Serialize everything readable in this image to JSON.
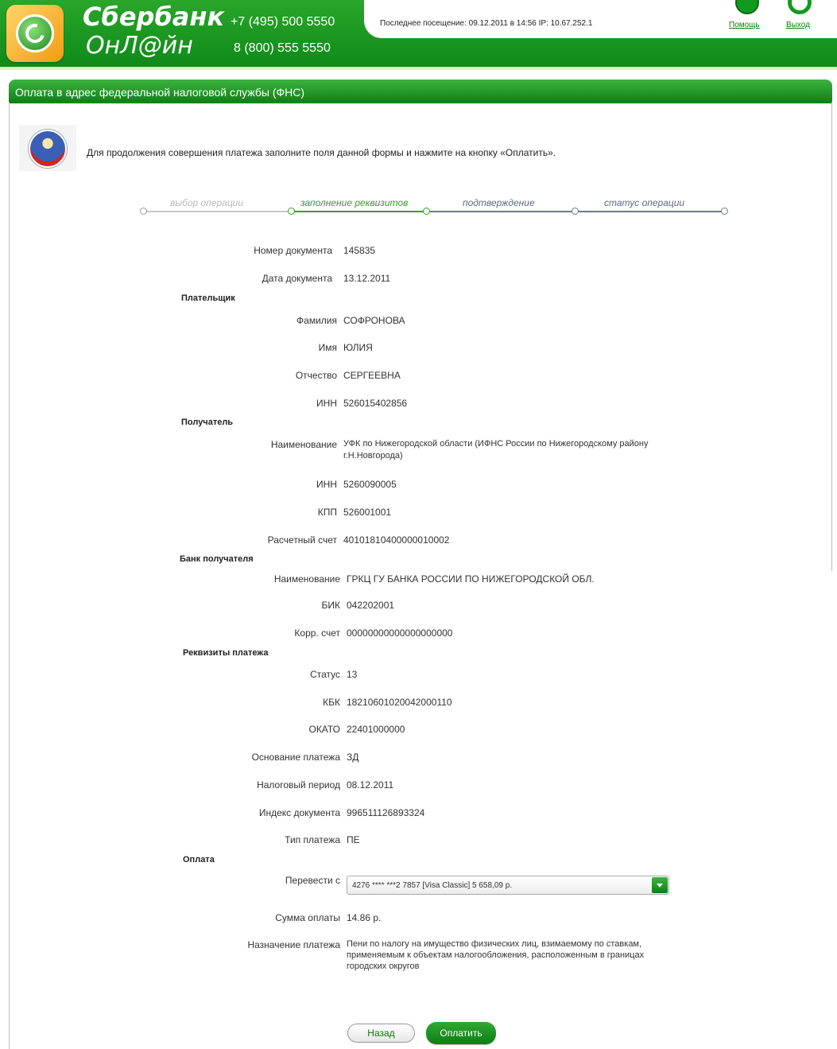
{
  "header": {
    "brand_line1": "Сбербанк",
    "brand_line2": "ОнЛ@йн",
    "phone1": "+7 (495) 500 5550",
    "phone2": "8 (800) 555 5550",
    "last_visit": "Последнее посещение: 09.12.2011 в 14:56 IP: 10.67.252.1",
    "help_link": "Помощь",
    "exit_link": "Выход"
  },
  "panel": {
    "title": "Оплата в адрес федеральной налоговой службы (ФНС)",
    "instructions": "Для продолжения совершения платежа заполните поля данной формы и нажмите на кнопку «Оплатить»."
  },
  "steps": [
    {
      "label": "выбор операции",
      "state": "done"
    },
    {
      "label": "заполнение реквизитов",
      "state": "active"
    },
    {
      "label": "подтверждение",
      "state": "pending"
    },
    {
      "label": "статус операции",
      "state": "pending"
    }
  ],
  "form": {
    "doc_number_label": "Номер документа",
    "doc_number": "145835",
    "doc_date_label": "Дата документа",
    "doc_date": "13.12.2011",
    "payer_section": "Плательщик",
    "surname_label": "Фамилия",
    "surname": "СОФРОНОВА",
    "name_label": "Имя",
    "name": "ЮЛИЯ",
    "patronymic_label": "Отчество",
    "patronymic": "СЕРГЕЕВНА",
    "payer_inn_label": "ИНН",
    "payer_inn": "526015402856",
    "recipient_section": "Получатель",
    "recipient_name_label": "Наименование",
    "recipient_name_line1": "УФК по Нижегородской области (ИФНС России по Нижегородскому району",
    "recipient_name_line2": "г.Н.Новгорода)",
    "recipient_inn_label": "ИНН",
    "recipient_inn": "5260090005",
    "kpp_label": "КПП",
    "kpp": "526001001",
    "account_label": "Расчетный счет",
    "account": "40101810400000010002",
    "bank_section": "Банк получателя",
    "bank_name_label": "Наименование",
    "bank_name": "ГРКЦ ГУ БАНКА РОССИИ ПО НИЖЕГОРОДСКОЙ ОБЛ.",
    "bik_label": "БИК",
    "bik": "042202001",
    "corr_label": "Корр. счет",
    "corr": "00000000000000000000",
    "payment_section": "Реквизиты платежа",
    "status_label": "Статус",
    "status": "13",
    "kbk_label": "КБК",
    "kbk": "18210601020042000110",
    "okato_label": "ОКАТО",
    "okato": "22401000000",
    "basis_label": "Основание платежа",
    "basis": "ЗД",
    "period_label": "Налоговый период",
    "period": "08.12.2011",
    "doc_index_label": "Индекс документа",
    "doc_index": "996511126893324",
    "pay_type_label": "Тип платежа",
    "pay_type": "ПЕ",
    "pay_section": "Оплата",
    "transfer_from_label": "Перевести с",
    "transfer_from": "4276 **** ***2 7857  [Visa Classic] 5 658,09  р.",
    "amount_label": "Сумма оплаты",
    "amount": "14.86  р.",
    "purpose_label": "Назначение платежа",
    "purpose_line1": "Пени по налогу на имущество физических лиц, взимаемому по ставкам,",
    "purpose_line2": "применяемым к объектам налогообложения, расположенным в границах",
    "purpose_line3": "городских округов"
  },
  "buttons": {
    "back": "Назад",
    "pay": "Оплатить"
  },
  "colors": {
    "brand_green": "#0f8a19",
    "step_active": "#3a9a2a",
    "step_pending": "#6b7b8c",
    "step_done": "#c8c8c8"
  }
}
